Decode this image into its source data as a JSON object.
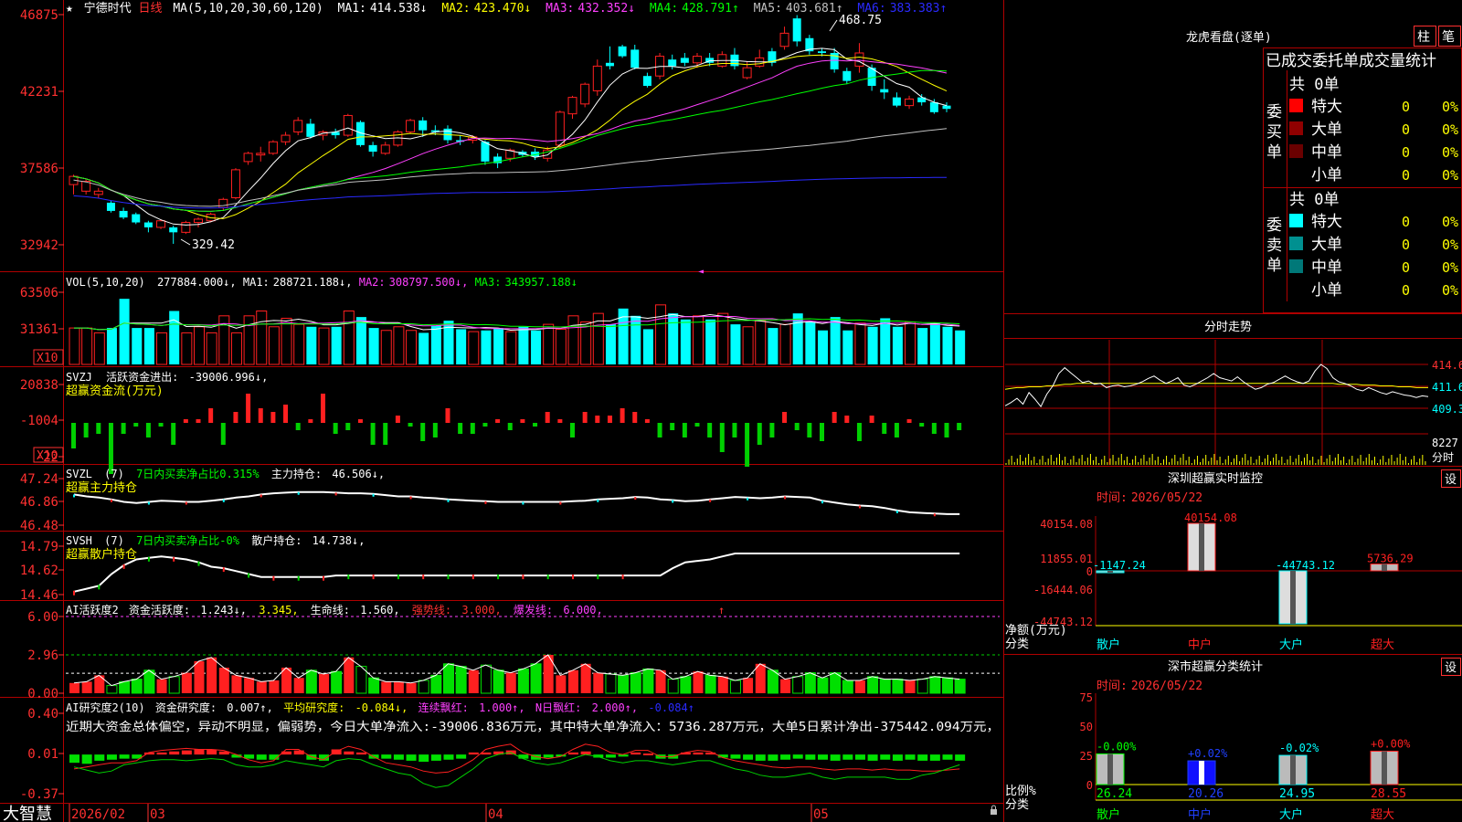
{
  "app": {
    "name": "大智慧"
  },
  "stock": {
    "name": "宁德时代",
    "period": "日线"
  },
  "colors": {
    "up": "#ff2020",
    "down": "#00ffff",
    "grid": "#b00000",
    "axis_text": "#ff3030",
    "ma1": "#ffffff",
    "ma2": "#ffff00",
    "ma3": "#ff40ff",
    "ma4": "#00ff00",
    "ma5": "#c0c0c0",
    "ma6": "#2a2aff",
    "green": "#00d000",
    "yellow": "#ffff00",
    "magenta": "#ff40ff",
    "blue": "#2060ff"
  },
  "candle_panel": {
    "header": {
      "star": "★",
      "ma_params": "MA(5,10,20,30,60,120)",
      "ma": [
        {
          "label": "MA1:",
          "value": "414.538↓"
        },
        {
          "label": "MA2:",
          "value": "423.470↓"
        },
        {
          "label": "MA3:",
          "value": "432.352↓"
        },
        {
          "label": "MA4:",
          "value": "428.791↑"
        },
        {
          "label": "MA5:",
          "value": "403.681↑"
        },
        {
          "label": "MA6:",
          "value": "383.383↑"
        }
      ]
    },
    "y_ticks": [
      "46875",
      "42231",
      "37586",
      "32942"
    ],
    "high_label": "468.75",
    "low_label": "329.42",
    "cursor_mark": "◄"
  },
  "candles": [
    [
      366,
      371,
      360,
      372
    ],
    [
      362,
      368,
      360,
      369
    ],
    [
      360,
      362,
      358,
      364
    ],
    [
      355,
      350,
      349,
      356
    ],
    [
      350,
      346,
      345,
      352
    ],
    [
      348,
      343,
      342,
      349
    ],
    [
      343,
      340,
      337,
      344
    ],
    [
      340,
      344,
      339,
      345
    ],
    [
      340,
      337,
      330,
      341
    ],
    [
      337,
      343,
      336,
      344
    ],
    [
      343,
      345,
      340,
      346
    ],
    [
      344,
      348,
      343,
      349
    ],
    [
      352,
      357,
      350,
      358
    ],
    [
      358,
      375,
      357,
      376
    ],
    [
      380,
      385,
      378,
      386
    ],
    [
      384,
      385,
      380,
      389
    ],
    [
      385,
      392,
      384,
      393
    ],
    [
      392,
      396,
      390,
      398
    ],
    [
      398,
      405,
      396,
      407
    ],
    [
      403,
      395,
      394,
      406
    ],
    [
      396,
      398,
      393,
      399
    ],
    [
      398,
      396,
      394,
      400
    ],
    [
      396,
      408,
      395,
      409
    ],
    [
      404,
      390,
      389,
      405
    ],
    [
      390,
      386,
      383,
      392
    ],
    [
      385,
      390,
      384,
      392
    ],
    [
      390,
      398,
      389,
      399
    ],
    [
      398,
      405,
      397,
      406
    ],
    [
      405,
      399,
      395,
      407
    ],
    [
      399,
      398,
      396,
      402
    ],
    [
      400,
      393,
      391,
      402
    ],
    [
      393,
      392,
      390,
      396
    ],
    [
      393,
      395,
      391,
      396
    ],
    [
      392,
      380,
      378,
      393
    ],
    [
      383,
      379,
      376,
      385
    ],
    [
      382,
      387,
      380,
      388
    ],
    [
      386,
      384,
      383,
      387
    ],
    [
      386,
      383,
      381,
      388
    ],
    [
      382,
      387,
      380,
      389
    ],
    [
      390,
      410,
      388,
      411
    ],
    [
      409,
      419,
      406,
      420
    ],
    [
      415,
      427,
      413,
      428
    ],
    [
      423,
      438,
      420,
      442
    ],
    [
      440,
      438,
      436,
      450
    ],
    [
      450,
      444,
      443,
      451
    ],
    [
      448,
      437,
      436,
      451
    ],
    [
      432,
      426,
      425,
      434
    ],
    [
      432,
      444,
      430,
      446
    ],
    [
      442,
      438,
      436,
      445
    ],
    [
      443,
      440,
      438,
      446
    ],
    [
      440,
      444,
      437,
      446
    ],
    [
      443,
      440,
      438,
      446
    ],
    [
      438,
      445,
      437,
      447
    ],
    [
      445,
      438,
      436,
      449
    ],
    [
      431,
      437,
      430,
      441
    ],
    [
      438,
      443,
      437,
      448
    ],
    [
      447,
      440,
      438,
      449
    ],
    [
      450,
      458,
      448,
      462
    ],
    [
      467,
      453,
      450,
      469
    ],
    [
      455,
      447,
      445,
      457
    ],
    [
      447,
      446,
      444,
      449
    ],
    [
      446,
      436,
      434,
      449
    ],
    [
      435,
      429,
      427,
      437
    ],
    [
      438,
      446,
      434,
      452
    ],
    [
      437,
      426,
      423,
      439
    ],
    [
      424,
      422,
      418,
      430
    ],
    [
      419,
      414,
      413,
      422
    ],
    [
      414,
      418,
      412,
      420
    ],
    [
      419,
      416,
      414,
      421
    ],
    [
      416,
      410,
      409,
      418
    ],
    [
      414,
      412,
      410,
      416
    ]
  ],
  "volume_panel": {
    "header": {
      "params": "VOL(5,10,20)",
      "value": "277884.000↓,",
      "ma": [
        {
          "label": "MA1:",
          "value": "288721.188↓,"
        },
        {
          "label": "MA2:",
          "value": "308797.500↓,"
        },
        {
          "label": "MA3:",
          "value": "343957.188↓"
        }
      ]
    },
    "y_ticks": [
      "63506",
      "31361"
    ],
    "unit": "X10",
    "values": [
      30,
      30,
      26,
      30,
      54,
      30,
      30,
      26,
      44,
      26,
      31,
      26,
      40,
      26,
      40,
      44,
      31,
      38,
      33,
      31,
      30,
      31,
      44,
      39,
      30,
      28,
      31,
      28,
      26,
      32,
      36,
      29,
      27,
      28,
      30,
      27,
      31,
      28,
      33,
      29,
      40,
      35,
      42,
      33,
      46,
      40,
      29,
      49,
      42,
      37,
      40,
      37,
      42,
      33,
      31,
      36,
      30,
      33,
      42,
      35,
      28,
      39,
      28,
      34,
      31,
      38,
      31,
      35,
      30,
      34,
      31,
      28
    ]
  },
  "svzj_panel": {
    "header": {
      "title": "SVZJ",
      "label": "活跃资金进出:",
      "value": "-39006.996↓,",
      "sub": "超赢资金流(万元)"
    },
    "y_ticks": [
      "20838",
      "-1004",
      "-22"
    ],
    "unit": "X10",
    "values": [
      -7,
      -4,
      -3,
      -14,
      -3,
      -1,
      -4,
      -1,
      -6,
      1,
      1,
      4,
      -6,
      3,
      8,
      4,
      3,
      5,
      -2,
      1,
      8,
      -3,
      -2,
      1,
      -6,
      -6,
      2,
      -1,
      -5,
      -4,
      4,
      -3,
      -3,
      -1,
      1,
      -2,
      1,
      -1,
      3,
      1,
      -4,
      3,
      2,
      2,
      4,
      3,
      1,
      -4,
      -2,
      -4,
      -1,
      -4,
      -8,
      -4,
      -12,
      -6,
      -4,
      3,
      -2,
      -4,
      -5,
      3,
      2,
      -5,
      2,
      -3,
      -4,
      1,
      -1,
      -3,
      -4,
      -2,
      -1,
      -2,
      1,
      -2,
      -3,
      -1
    ]
  },
  "svzl_panel": {
    "header": {
      "title": "SVZL",
      "params": "(7)",
      "label": "7日内买卖净占比0.315%",
      "value_label": "主力持仓:",
      "value": "46.506↓,",
      "sub": "超赢主力持仓"
    },
    "y_ticks": [
      "47.24",
      "46.86",
      "46.48"
    ],
    "values": [
      46.98,
      46.95,
      46.93,
      46.9,
      46.86,
      46.84,
      46.86,
      46.88,
      46.87,
      46.86,
      46.86,
      46.88,
      46.9,
      46.93,
      46.95,
      46.98,
      47.0,
      47.01,
      47.02,
      47.02,
      47.02,
      47.01,
      47.0,
      47.0,
      46.99,
      46.97,
      46.95,
      46.95,
      46.93,
      46.92,
      46.9,
      46.89,
      46.88,
      46.87,
      46.86,
      46.86,
      46.86,
      46.86,
      46.86,
      46.86,
      46.87,
      46.88,
      46.9,
      46.91,
      46.92,
      46.94,
      46.93,
      46.9,
      46.89,
      46.87,
      46.88,
      46.9,
      46.92,
      46.94,
      46.93,
      46.92,
      46.93,
      46.95,
      46.94,
      46.93,
      46.88,
      46.85,
      46.82,
      46.8,
      46.79,
      46.76,
      46.72,
      46.69,
      46.68,
      46.67,
      46.66,
      46.66
    ]
  },
  "svsh_panel": {
    "header": {
      "title": "SVSH",
      "params": "(7)",
      "label": "7日内买卖净占比-0%",
      "value_label": "散户持仓:",
      "value": "14.738↓,",
      "sub": "超赢散户持仓"
    },
    "y_ticks": [
      "14.79",
      "14.62",
      "14.46"
    ],
    "values": [
      14.48,
      14.5,
      14.52,
      14.6,
      14.66,
      14.7,
      14.71,
      14.72,
      14.71,
      14.7,
      14.68,
      14.65,
      14.64,
      14.62,
      14.6,
      14.58,
      14.58,
      14.58,
      14.58,
      14.58,
      14.58,
      14.59,
      14.59,
      14.59,
      14.59,
      14.59,
      14.59,
      14.59,
      14.59,
      14.59,
      14.59,
      14.59,
      14.59,
      14.59,
      14.59,
      14.59,
      14.59,
      14.59,
      14.59,
      14.59,
      14.59,
      14.59,
      14.59,
      14.59,
      14.59,
      14.59,
      14.59,
      14.59,
      14.64,
      14.68,
      14.69,
      14.7,
      14.72,
      14.74,
      14.74,
      14.74,
      14.74,
      14.74,
      14.74,
      14.74,
      14.74,
      14.74,
      14.74,
      14.74,
      14.74,
      14.74,
      14.74,
      14.74,
      14.74,
      14.74,
      14.74,
      14.74
    ]
  },
  "ai_active_panel": {
    "header": {
      "title": "AI活跃度2",
      "label": "资金活跃度:",
      "value": "1.243↓,",
      "value2": "3.345,",
      "life_label": "生命线:",
      "life_value": "1.560,",
      "strong_label": "强势线:",
      "strong_value": "3.000,",
      "burst_label": "爆发线:",
      "burst_value": "6.000,",
      "marker": "↑"
    },
    "y_ticks": [
      "6.00",
      "2.96",
      "0.00"
    ],
    "values": [
      0.8,
      0.9,
      1.4,
      0.6,
      0.9,
      1.1,
      1.8,
      1.1,
      1.3,
      1.6,
      2.5,
      2.8,
      2.0,
      1.4,
      1.2,
      0.9,
      1.0,
      2.0,
      1.2,
      1.8,
      1.5,
      1.7,
      2.8,
      2.1,
      1.2,
      0.9,
      0.9,
      0.8,
      1.0,
      1.4,
      2.3,
      2.1,
      1.8,
      2.2,
      1.8,
      1.6,
      1.9,
      2.3,
      3.0,
      1.4,
      1.8,
      2.3,
      1.6,
      1.5,
      1.4,
      1.6,
      1.9,
      1.8,
      1.1,
      1.3,
      1.7,
      1.4,
      1.3,
      1.0,
      1.2,
      2.3,
      1.8,
      1.1,
      1.3,
      1.6,
      1.2,
      1.6,
      1.0,
      1.0,
      1.3,
      1.1,
      1.1,
      1.0,
      1.1,
      1.3,
      1.2,
      1.1
    ]
  },
  "ai_research_panel": {
    "header": {
      "title": "AI研究度2(10)",
      "label": "资金研究度:",
      "value": "0.007↑,",
      "avg_label": "平均研究度:",
      "avg_value": "-0.084↓,",
      "streak_label": "连续飘红:",
      "streak_value": "1.000↑,",
      "n_label": "N日飘红:",
      "n_value": "2.000↑,",
      "tail": "-0.084↑"
    },
    "summary": "近期大资金总体偏空，异动不明显，偏弱势，今日大单净流入:-39006.836万元，其中特大单净流入：5736.287万元，大单5日累计净出-375442.094万元，",
    "y_ticks": [
      "0.40",
      "0.01",
      "-0.37"
    ],
    "bars": [
      -0.08,
      -0.09,
      -0.06,
      -0.05,
      -0.04,
      -0.04,
      0.02,
      0.02,
      0.03,
      0.04,
      0.05,
      0.05,
      0.03,
      -0.03,
      -0.04,
      -0.05,
      -0.05,
      0.03,
      0.04,
      -0.05,
      -0.06,
      0.05,
      0.03,
      0.02,
      -0.04,
      -0.04,
      -0.05,
      -0.06,
      -0.07,
      -0.06,
      -0.05,
      -0.04,
      0.02,
      0.02,
      0.03,
      0.04,
      -0.04,
      -0.05,
      -0.03,
      -0.02,
      0.02,
      0.03,
      -0.03,
      -0.03,
      -0.02,
      0.02,
      0.01,
      -0.04,
      -0.04,
      0.02,
      0.02,
      0.02,
      -0.03,
      -0.04,
      -0.05,
      -0.06,
      -0.06,
      -0.05,
      -0.04,
      -0.05,
      -0.05,
      -0.06,
      -0.05,
      -0.05,
      -0.06,
      -0.05,
      -0.06,
      -0.05,
      -0.06,
      -0.06,
      -0.05,
      -0.06
    ],
    "red_line": [
      -0.14,
      -0.12,
      -0.1,
      -0.08,
      -0.08,
      -0.06,
      0.02,
      0.04,
      0.05,
      0.06,
      0.05,
      0.05,
      0.04,
      0.0,
      -0.05,
      -0.08,
      -0.06,
      0.05,
      0.05,
      -0.02,
      -0.05,
      0.03,
      0.08,
      0.05,
      -0.02,
      -0.08,
      -0.1,
      -0.12,
      -0.16,
      -0.18,
      -0.17,
      -0.12,
      -0.05,
      0.05,
      0.08,
      0.1,
      0.02,
      -0.02,
      -0.04,
      -0.02,
      0.05,
      0.1,
      0.08,
      0.02,
      0.0,
      0.04,
      0.04,
      -0.02,
      -0.02,
      0.02,
      0.04,
      0.03,
      -0.03,
      -0.06,
      -0.08,
      -0.1,
      -0.12,
      -0.13,
      -0.12,
      -0.12,
      -0.14,
      -0.15,
      -0.14,
      -0.14,
      -0.15,
      -0.14,
      -0.15,
      -0.15,
      -0.16,
      -0.16,
      -0.15,
      -0.14
    ],
    "green_line": [
      -0.12,
      -0.15,
      -0.18,
      -0.16,
      -0.1,
      -0.08,
      -0.06,
      -0.05,
      -0.05,
      -0.06,
      -0.05,
      -0.04,
      -0.05,
      -0.1,
      -0.12,
      -0.12,
      -0.1,
      -0.06,
      -0.08,
      -0.1,
      -0.12,
      -0.06,
      -0.04,
      -0.05,
      -0.1,
      -0.14,
      -0.18,
      -0.2,
      -0.28,
      -0.32,
      -0.3,
      -0.22,
      -0.14,
      -0.04,
      0.0,
      0.02,
      -0.04,
      -0.08,
      -0.1,
      -0.08,
      -0.04,
      0.0,
      -0.02,
      -0.06,
      -0.08,
      -0.06,
      -0.06,
      -0.08,
      -0.1,
      -0.08,
      -0.06,
      -0.06,
      -0.1,
      -0.14,
      -0.16,
      -0.2,
      -0.22,
      -0.22,
      -0.2,
      -0.18,
      -0.22,
      -0.24,
      -0.22,
      -0.22,
      -0.22,
      -0.22,
      -0.24,
      -0.24,
      -0.2,
      -0.18,
      -0.14,
      -0.1
    ]
  },
  "date_axis": {
    "labels": [
      "2026/02",
      "03",
      "04",
      "05"
    ]
  },
  "dragon_tiger": {
    "title": "龙虎看盘(逐单)",
    "mode_buttons": [
      "柱",
      "笔"
    ],
    "tabs": [
      "已成交",
      "委托单",
      "成交量统计"
    ],
    "buy_label": "委买单",
    "sell_label": "委卖单",
    "buy_total": "共 0单",
    "sell_total": "共 0单",
    "buy_rows": [
      {
        "name": "特大",
        "count": "0",
        "pct": "0%",
        "color": "#ff0000"
      },
      {
        "name": "大单",
        "count": "0",
        "pct": "0%",
        "color": "#900000"
      },
      {
        "name": "中单",
        "count": "0",
        "pct": "0%",
        "color": "#6a0000"
      },
      {
        "name": "小单",
        "count": "0",
        "pct": "0%",
        "color": "#000000"
      }
    ],
    "sell_rows": [
      {
        "name": "特大",
        "count": "0",
        "pct": "0%",
        "color": "#00ffff"
      },
      {
        "name": "大单",
        "count": "0",
        "pct": "0%",
        "color": "#009090"
      },
      {
        "name": "中单",
        "count": "0",
        "pct": "0%",
        "color": "#007878"
      },
      {
        "name": "小单",
        "count": "0",
        "pct": "0%",
        "color": "#000000"
      }
    ]
  },
  "intraday": {
    "title": "分时走势",
    "y_ticks": [
      "414.6",
      "411.6",
      "409.3"
    ],
    "vol_value": "8227",
    "vol_label": "分时",
    "price": [
      409.6,
      410.0,
      410.5,
      409.8,
      411.2,
      410.4,
      409.5,
      411.0,
      412.0,
      413.5,
      414.2,
      413.6,
      413.0,
      412.4,
      412.6,
      412.2,
      412.3,
      411.8,
      412.0,
      412.1,
      411.9,
      412.0,
      412.2,
      412.5,
      412.9,
      413.2,
      412.7,
      412.3,
      412.6,
      413.0,
      412.1,
      411.9,
      412.2,
      412.6,
      413.0,
      413.5,
      413.0,
      412.8,
      412.6,
      413.1,
      412.5,
      412.0,
      411.6,
      411.8,
      412.2,
      412.4,
      412.8,
      413.2,
      412.8,
      412.5,
      412.3,
      412.6,
      413.8,
      414.6,
      414.1,
      413.0,
      412.5,
      412.3,
      412.0,
      411.6,
      411.4,
      411.8,
      411.5,
      411.2,
      411.0,
      411.3,
      411.1,
      410.9,
      410.8,
      410.6,
      410.8,
      410.7
    ],
    "avg": [
      411.6,
      411.7,
      411.8,
      411.8,
      411.9,
      411.9,
      411.9,
      412.0,
      412.0,
      412.1,
      412.2,
      412.2,
      412.3,
      412.3,
      412.3,
      412.3,
      412.3,
      412.3,
      412.3,
      412.3,
      412.3,
      412.3,
      412.3,
      412.3,
      412.3,
      412.3,
      412.3,
      412.3,
      412.3,
      412.3,
      412.3,
      412.3,
      412.3,
      412.3,
      412.3,
      412.3,
      412.3,
      412.3,
      412.3,
      412.3,
      412.3,
      412.3,
      412.3,
      412.3,
      412.3,
      412.3,
      412.3,
      412.3,
      412.3,
      412.3,
      412.3,
      412.3,
      412.3,
      412.3,
      412.3,
      412.3,
      412.2,
      412.2,
      412.2,
      412.2,
      412.1,
      412.1,
      412.1,
      412.0,
      412.0,
      412.0,
      411.9,
      411.9,
      411.9,
      411.8,
      411.8,
      411.8
    ]
  },
  "monitor": {
    "title": "深圳超赢实时监控",
    "settings": "设",
    "time_label": "时间:",
    "time_value": "2026/05/22",
    "y_ticks": [
      "40154.08",
      "11855.01",
      "0",
      "-16444.06",
      "-44743.12"
    ],
    "y_title": "净额(万元)",
    "x_title": "分类",
    "categories": [
      "散户",
      "中户",
      "大户",
      "超大"
    ],
    "values": [
      -1147.24,
      40154.08,
      -44743.12,
      5736.29
    ],
    "value_labels": [
      "-1147.24",
      "40154.08",
      "-44743.12",
      "5736.29"
    ]
  },
  "classify": {
    "title": "深市超赢分类统计",
    "settings": "设",
    "time_label": "时间:",
    "time_value": "2026/05/22",
    "y_ticks": [
      "75",
      "50",
      "25",
      "0"
    ],
    "y_title": "比例%",
    "x_title": "分类",
    "categories": [
      "散户",
      "中户",
      "大户",
      "超大"
    ],
    "values": [
      26.24,
      20.26,
      24.95,
      28.55
    ],
    "value_labels": [
      "26.24",
      "20.26",
      "24.95",
      "28.55"
    ],
    "change_labels": [
      "-0.00%",
      "+0.02%",
      "-0.02%",
      "+0.00%"
    ]
  }
}
